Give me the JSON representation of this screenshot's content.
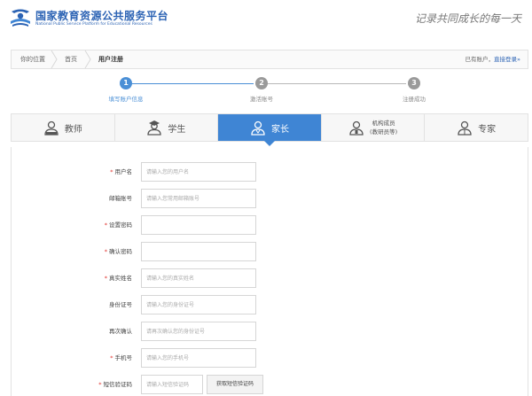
{
  "header": {
    "title": "国家教育资源公共服务平台",
    "subtitle": "National Public Service Platform for Educational Resources",
    "slogan": "记录共同成长的每一天"
  },
  "breadcrumb": {
    "prefix": "你的位置",
    "home": "首页",
    "current": "用户注册",
    "has_account": "已有账户，",
    "login_link": "直接登录»"
  },
  "steps": [
    {
      "num": "1",
      "label": "填写账户信息",
      "active": true
    },
    {
      "num": "2",
      "label": "激活账号",
      "active": false
    },
    {
      "num": "3",
      "label": "注册成功",
      "active": false
    }
  ],
  "tabs": [
    {
      "label": "教师",
      "icon": "teacher-icon"
    },
    {
      "label": "学生",
      "icon": "student-icon"
    },
    {
      "label": "家长",
      "icon": "parent-icon",
      "active": true
    },
    {
      "label_line1": "机构成员",
      "label_line2": "(教研员等)",
      "icon": "institution-member-icon"
    },
    {
      "label": "专家",
      "icon": "expert-icon"
    }
  ],
  "form": {
    "username": {
      "label": "用户名",
      "placeholder": "请输入您的用户名",
      "required": true
    },
    "email": {
      "label": "邮箱账号",
      "placeholder": "请输入您常用邮箱账号",
      "required": false
    },
    "password": {
      "label": "设置密码",
      "placeholder": "",
      "required": true
    },
    "confirm_password": {
      "label": "确认密码",
      "placeholder": "",
      "required": true
    },
    "real_name": {
      "label": "真实姓名",
      "placeholder": "请输入您的真实姓名",
      "required": true
    },
    "id_number": {
      "label": "身份证号",
      "placeholder": "请输入您的身份证号",
      "required": false
    },
    "id_confirm": {
      "label": "再次确认",
      "placeholder": "请再次确认您的身份证号",
      "required": false
    },
    "phone": {
      "label": "手机号",
      "placeholder": "请输入您的手机号",
      "required": true
    },
    "sms_code": {
      "label": "短信验证码",
      "placeholder": "请输入短信验证码",
      "required": true,
      "button": "获取短信验证码"
    }
  },
  "required_mark": "*",
  "colors": {
    "brand": "#2c63b4",
    "accent": "#3f85d4",
    "required": "#e0322d"
  }
}
